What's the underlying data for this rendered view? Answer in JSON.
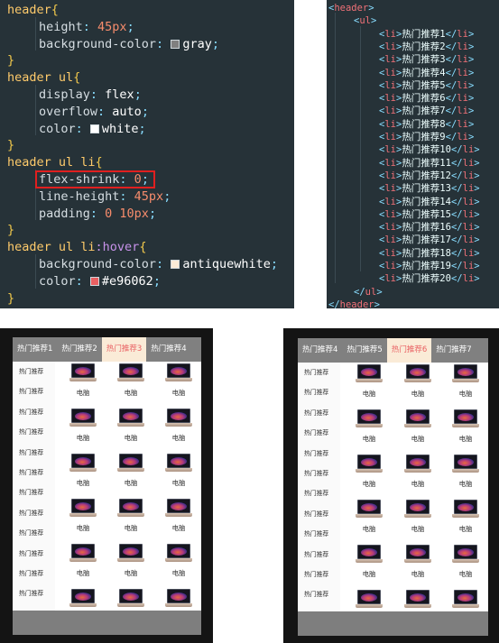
{
  "css_editor": {
    "lines": [
      {
        "type": "rule",
        "text": "header"
      },
      {
        "type": "decl",
        "prop": "height",
        "value": "45px",
        "value_kind": "num"
      },
      {
        "type": "decl",
        "prop": "background-color",
        "value": "gray",
        "value_kind": "color",
        "swatch": "#808080"
      },
      {
        "type": "close"
      },
      {
        "type": "rule",
        "text": "header ul"
      },
      {
        "type": "decl",
        "prop": "display",
        "value": "flex",
        "value_kind": "word"
      },
      {
        "type": "decl",
        "prop": "overflow",
        "value": "auto",
        "value_kind": "word"
      },
      {
        "type": "decl",
        "prop": "color",
        "value": "white",
        "value_kind": "color",
        "swatch": "#ffffff"
      },
      {
        "type": "close"
      },
      {
        "type": "rule",
        "text": "header ul li"
      },
      {
        "type": "decl",
        "prop": "flex-shrink",
        "value": "0",
        "value_kind": "num",
        "highlight": true
      },
      {
        "type": "decl",
        "prop": "line-height",
        "value": "45px",
        "value_kind": "num"
      },
      {
        "type": "decl",
        "prop": "padding",
        "value": "0 10px",
        "value_kind": "num"
      },
      {
        "type": "close"
      },
      {
        "type": "rule",
        "text": "header ul li",
        "pseudo": ":hover"
      },
      {
        "type": "decl",
        "prop": "background-color",
        "value": "antiquewhite",
        "value_kind": "color",
        "swatch": "#faebd7"
      },
      {
        "type": "decl",
        "prop": "color",
        "value": "#e96062",
        "value_kind": "color",
        "swatch": "#e96062"
      },
      {
        "type": "close"
      }
    ]
  },
  "html_editor": {
    "open_header": "header",
    "open_ul": "ul",
    "items": [
      "热门推荐1",
      "热门推荐2",
      "热门推荐3",
      "热门推荐4",
      "热门推荐5",
      "热门推荐6",
      "热门推荐7",
      "热门推荐8",
      "热门推荐9",
      "热门推荐10",
      "热门推荐11",
      "热门推荐12",
      "热门推荐13",
      "热门推荐14",
      "热门推荐15",
      "热门推荐16",
      "热门推荐17",
      "热门推荐18",
      "热门推荐19",
      "热门推荐20"
    ],
    "li_tag": "li",
    "close_ul": "ul",
    "close_header": "header"
  },
  "preview_left": {
    "tabs": [
      "热门推荐1",
      "热门推荐2",
      "热门推荐3",
      "热门推荐4"
    ],
    "active_tab": 2,
    "side_items": [
      "热门推荐",
      "热门推荐",
      "热门推荐",
      "热门推荐",
      "热门推荐",
      "热门推荐",
      "热门推荐",
      "热门推荐",
      "热门推荐",
      "热门推荐",
      "热门推荐",
      "热门推荐",
      "热门推荐"
    ],
    "product_label": "电脑",
    "rows": 6,
    "cols": 3
  },
  "preview_right": {
    "tabs": [
      "热门推荐4",
      "热门推荐5",
      "热门推荐6",
      "热门推荐7"
    ],
    "active_tab": 2,
    "side_items": [
      "热门推荐",
      "热门推荐",
      "热门推荐",
      "热门推荐",
      "热门推荐",
      "热门推荐",
      "热门推荐",
      "热门推荐",
      "热门推荐",
      "热门推荐",
      "热门推荐",
      "热门推荐",
      "热门推荐"
    ],
    "product_label": "电脑",
    "rows": 6,
    "cols": 3
  }
}
